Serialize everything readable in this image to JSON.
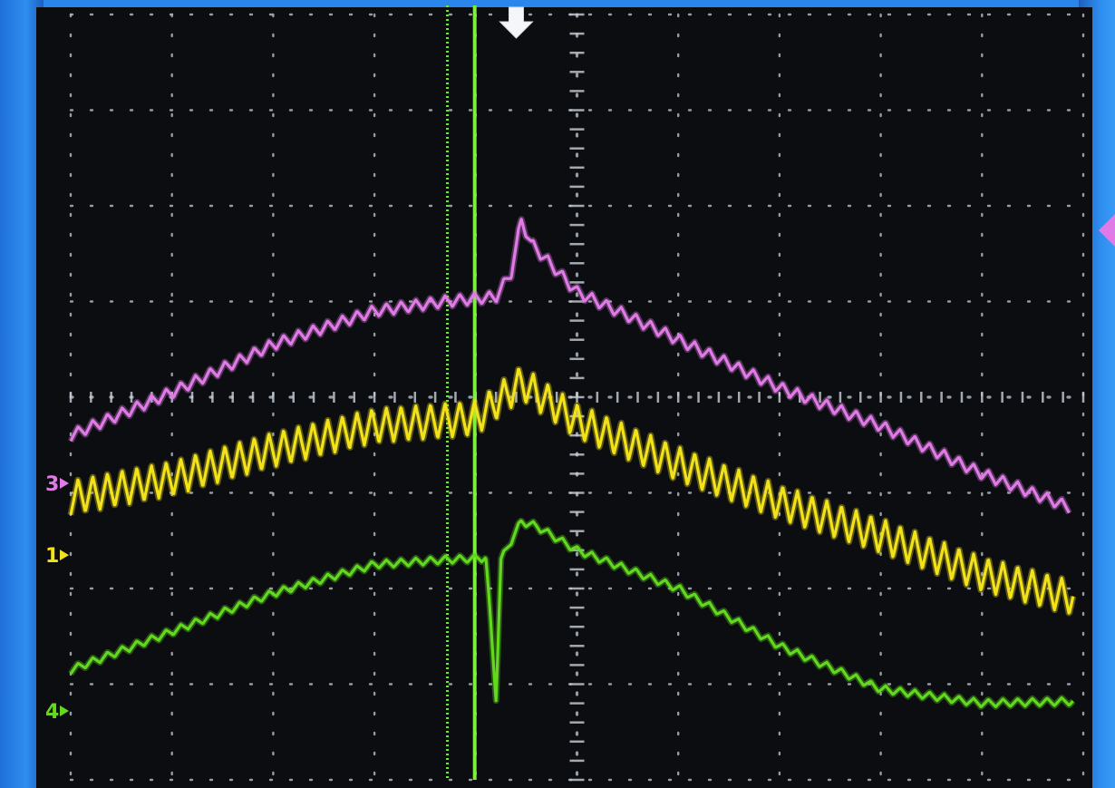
{
  "chart_data": {
    "type": "line",
    "title": "",
    "xlabel": "",
    "ylabel": "",
    "grid": true,
    "divisions": {
      "x": 10,
      "y": 8,
      "minor_per_div": 5
    },
    "xlim": [
      0,
      10
    ],
    "ylim": [
      0,
      8
    ],
    "trigger_marker": {
      "x": 4.4,
      "symbol": "⇩"
    },
    "cursors": [
      {
        "name": "cursor-a",
        "x": 3.72,
        "style": "dotted",
        "color": "#6ee63a"
      },
      {
        "name": "cursor-b",
        "x": 3.99,
        "style": "solid",
        "color": "#7cf03a"
      }
    ],
    "series": [
      {
        "channel_label": "3",
        "color": "#e07ae6",
        "ground_level": 3.1,
        "ripple_amplitude": 0.06,
        "points": [
          [
            0,
            3.6
          ],
          [
            1,
            4.05
          ],
          [
            2,
            4.55
          ],
          [
            3,
            4.9
          ],
          [
            3.7,
            5.0
          ],
          [
            4.2,
            5.05
          ],
          [
            4.35,
            5.3
          ],
          [
            4.45,
            5.85
          ],
          [
            4.55,
            5.6
          ],
          [
            5,
            5.1
          ],
          [
            6,
            4.6
          ],
          [
            7,
            4.1
          ],
          [
            8,
            3.7
          ],
          [
            9,
            3.2
          ],
          [
            9.86,
            2.85
          ]
        ]
      },
      {
        "channel_label": "1",
        "color": "#f2e21a",
        "ground_level": 2.35,
        "ripple_amplitude": 0.18,
        "points": [
          [
            0,
            2.95
          ],
          [
            1,
            3.15
          ],
          [
            2,
            3.45
          ],
          [
            3,
            3.7
          ],
          [
            4,
            3.78
          ],
          [
            4.45,
            4.15
          ],
          [
            5,
            3.75
          ],
          [
            6,
            3.3
          ],
          [
            7,
            2.9
          ],
          [
            8,
            2.55
          ],
          [
            9,
            2.15
          ],
          [
            9.9,
            1.9
          ]
        ]
      },
      {
        "channel_label": "4",
        "color": "#62d91e",
        "ground_level": 0.72,
        "ripple_amplitude": 0.04,
        "points": [
          [
            0,
            1.15
          ],
          [
            1,
            1.55
          ],
          [
            2,
            1.95
          ],
          [
            3,
            2.25
          ],
          [
            3.7,
            2.3
          ],
          [
            4.1,
            2.32
          ],
          [
            4.15,
            1.6
          ],
          [
            4.2,
            0.85
          ],
          [
            4.25,
            2.3
          ],
          [
            4.45,
            2.7
          ],
          [
            4.6,
            2.65
          ],
          [
            5,
            2.4
          ],
          [
            6,
            2.0
          ],
          [
            7,
            1.4
          ],
          [
            8,
            0.95
          ],
          [
            9,
            0.8
          ],
          [
            9.9,
            0.82
          ]
        ]
      }
    ]
  },
  "status_strip_text": ""
}
